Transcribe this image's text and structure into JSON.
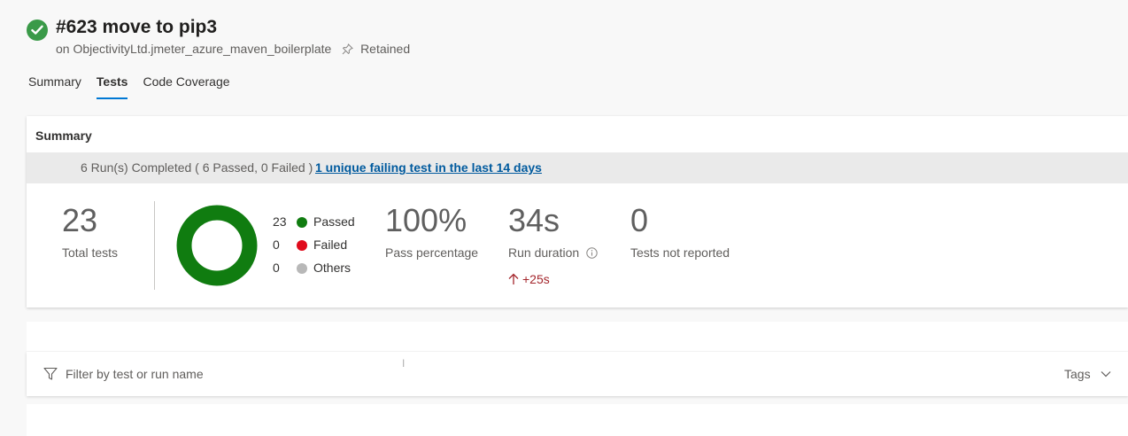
{
  "build": {
    "title": "#623 move to pip3",
    "subtitle": "on ObjectivityLtd.jmeter_azure_maven_boilerplate",
    "retained_label": "Retained",
    "status_icon": "check-circle-icon",
    "status_color": "#3a9a48"
  },
  "tabs": [
    {
      "label": "Summary",
      "active": false
    },
    {
      "label": "Tests",
      "active": true
    },
    {
      "label": "Code Coverage",
      "active": false
    }
  ],
  "summary": {
    "title": "Summary",
    "run_text": "6 Run(s) Completed ( 6 Passed, 0 Failed )",
    "failing_link": "1 unique failing test in the last 14 days",
    "total_tests": {
      "value": "23",
      "label": "Total tests"
    },
    "outcomes": [
      {
        "count": "23",
        "label": "Passed",
        "color": "#107c10"
      },
      {
        "count": "0",
        "label": "Failed",
        "color": "#e00b1c"
      },
      {
        "count": "0",
        "label": "Others",
        "color": "#b8b8b8"
      }
    ],
    "pass_percentage": {
      "value": "100%",
      "label": "Pass percentage"
    },
    "run_duration": {
      "value": "34s",
      "label": "Run duration",
      "delta": "+25s"
    },
    "not_reported": {
      "value": "0",
      "label": "Tests not reported"
    }
  },
  "filter": {
    "placeholder": "Filter by test or run name",
    "icon": "filter-icon",
    "tags_label": "Tags"
  }
}
